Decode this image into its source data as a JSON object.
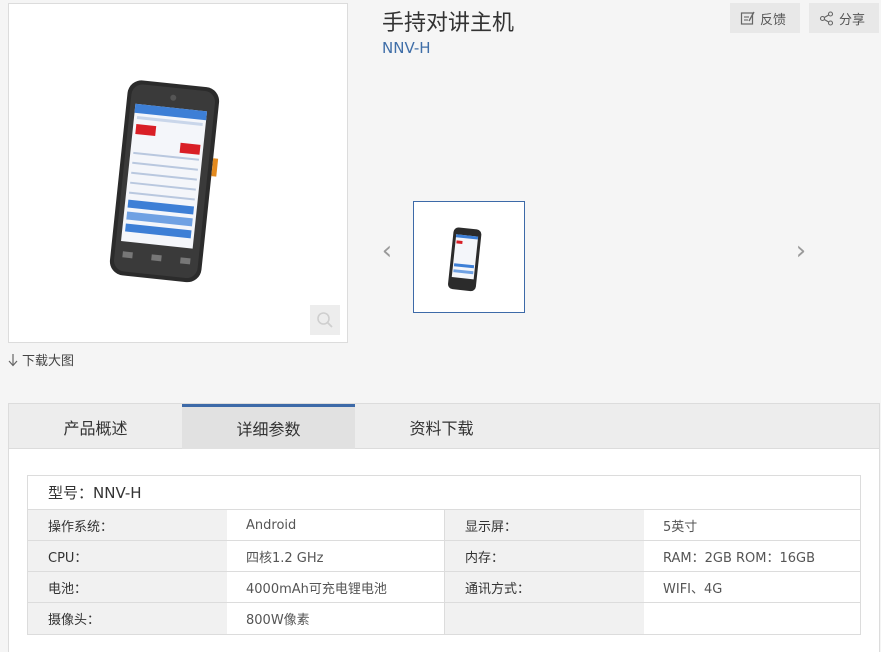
{
  "product": {
    "title": "手持对讲主机",
    "model": "NNV-H"
  },
  "actions": {
    "feedback_label": "反馈",
    "share_label": "分享"
  },
  "gallery": {
    "download_label": "下载大图"
  },
  "tabs": [
    {
      "label": "产品概述"
    },
    {
      "label": "详细参数"
    },
    {
      "label": "资料下载"
    }
  ],
  "specs": {
    "header": "型号：NNV-H",
    "rows": [
      {
        "label1": "操作系统：",
        "value1": "Android",
        "label2": "显示屏：",
        "value2": "5英寸"
      },
      {
        "label1": "CPU：",
        "value1": "四核1.2 GHz",
        "label2": "内存：",
        "value2": "RAM：2GB ROM：16GB"
      },
      {
        "label1": "电池：",
        "value1": "4000mAh可充电锂电池",
        "label2": "通讯方式：",
        "value2": "WIFI、4G"
      },
      {
        "label1": "摄像头：",
        "value1": "800W像素",
        "label2": "",
        "value2": ""
      }
    ]
  },
  "colors": {
    "accent": "#3d6aa8",
    "model_text": "#3f6ea8"
  }
}
